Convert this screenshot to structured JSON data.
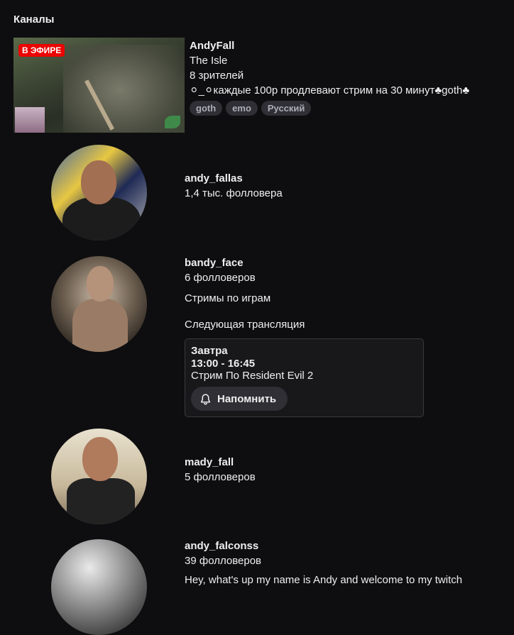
{
  "section": {
    "title": "Каналы"
  },
  "live_channel": {
    "badge": "В ЭФИРЕ",
    "name": "AndyFall",
    "game": "The Isle",
    "viewers": "8 зрителей",
    "stream_title": "⚪_⚪каждые 100р продлевают стрим на 30 минут♣goth♣",
    "tags": [
      "goth",
      "emo",
      "Русский"
    ]
  },
  "channels": [
    {
      "name": "andy_fallas",
      "followers": "1,4 тыс. фолловера"
    },
    {
      "name": "bandy_face",
      "followers": "6 фолловеров",
      "description": "Стримы по играм",
      "next_stream_label": "Следующая трансляция",
      "schedule": {
        "when": "Завтра",
        "time": "13:00 - 16:45",
        "title": "Стрим По Resident Evil 2",
        "remind_label": "Напомнить"
      }
    },
    {
      "name": "mady_fall",
      "followers": "5 фолловеров"
    },
    {
      "name": "andy_falconss",
      "followers": "39 фолловеров",
      "description": "Hey, what's up my name is Andy and welcome to my twitch"
    }
  ],
  "colors": {
    "background": "#0e0e10",
    "live_badge": "#eb0400",
    "tag_bg": "#2f2f35",
    "card_border": "#3a3a3d"
  },
  "icons": {
    "remind": "bell-icon"
  }
}
